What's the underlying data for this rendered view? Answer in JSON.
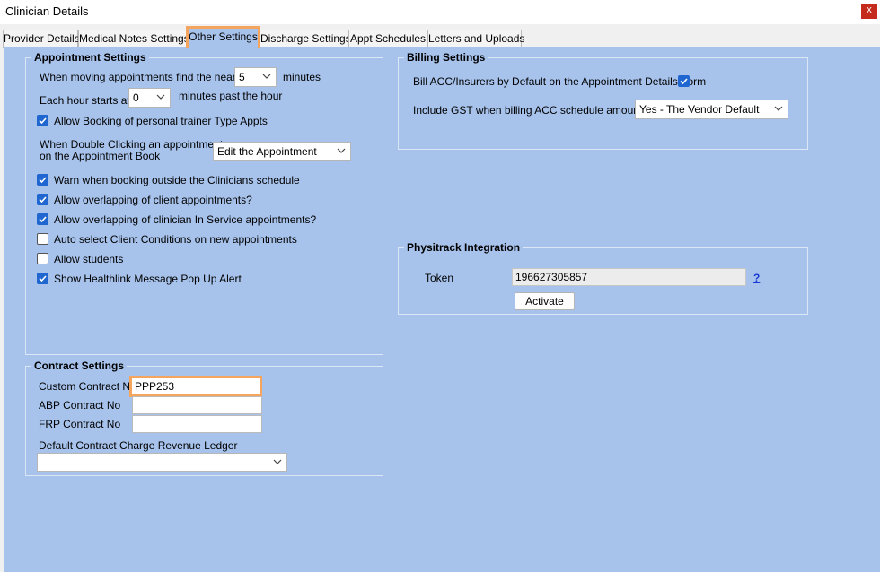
{
  "window": {
    "title": "Clinician Details",
    "close_label": "x"
  },
  "tabs": [
    {
      "label": "Provider Details"
    },
    {
      "label": "Medical Notes Settings"
    },
    {
      "label": "Other Settings"
    },
    {
      "label": "Discharge Settings"
    },
    {
      "label": "Appt Schedules"
    },
    {
      "label": "Letters and Uploads"
    }
  ],
  "appointment": {
    "title": "Appointment Settings",
    "nearest_label": "When moving appointments find the nearest",
    "nearest_value": "5",
    "minutes_label": "minutes",
    "hour_label": "Each hour starts at",
    "hour_value": "0",
    "hour_suffix": "minutes past the hour",
    "allow_pt_label": "Allow Booking of personal trainer Type Appts",
    "dblclick_label_1": "When Double Clicking an appointment",
    "dblclick_label_2": "on the Appointment Book",
    "dblclick_value": "Edit the Appointment",
    "checks": [
      {
        "label": "Warn when booking outside the Clinicians schedule",
        "checked": true
      },
      {
        "label": "Allow overlapping of client appointments?",
        "checked": true
      },
      {
        "label": "Allow overlapping of clinician In Service appointments?",
        "checked": true
      },
      {
        "label": "Auto select Client Conditions on new appointments",
        "checked": false
      },
      {
        "label": "Allow students",
        "checked": false
      },
      {
        "label": "Show Healthlink Message Pop Up Alert",
        "checked": true
      }
    ]
  },
  "contract": {
    "title": "Contract Settings",
    "custom_label": "Custom Contract No",
    "custom_value": "PPP253",
    "abp_label": "ABP Contract No",
    "abp_value": "",
    "frp_label": "FRP Contract No",
    "frp_value": "",
    "ledger_label": "Default Contract Charge Revenue Ledger",
    "ledger_value": ""
  },
  "billing": {
    "title": "Billing Settings",
    "bill_acc_label": "Bill ACC/Insurers by Default on the Appointment Details Form",
    "gst_label": "Include GST when billing ACC schedule amounts?",
    "gst_value": "Yes - The Vendor Default"
  },
  "physitrack": {
    "title": "Physitrack Integration",
    "token_label": "Token",
    "token_value": "196627305857",
    "help_label": "?",
    "activate_label": "Activate"
  },
  "colors": {
    "panel": "#a7c3ec",
    "highlight": "#f6a55e",
    "check": "#1f66d1",
    "close": "#c42b1c"
  }
}
